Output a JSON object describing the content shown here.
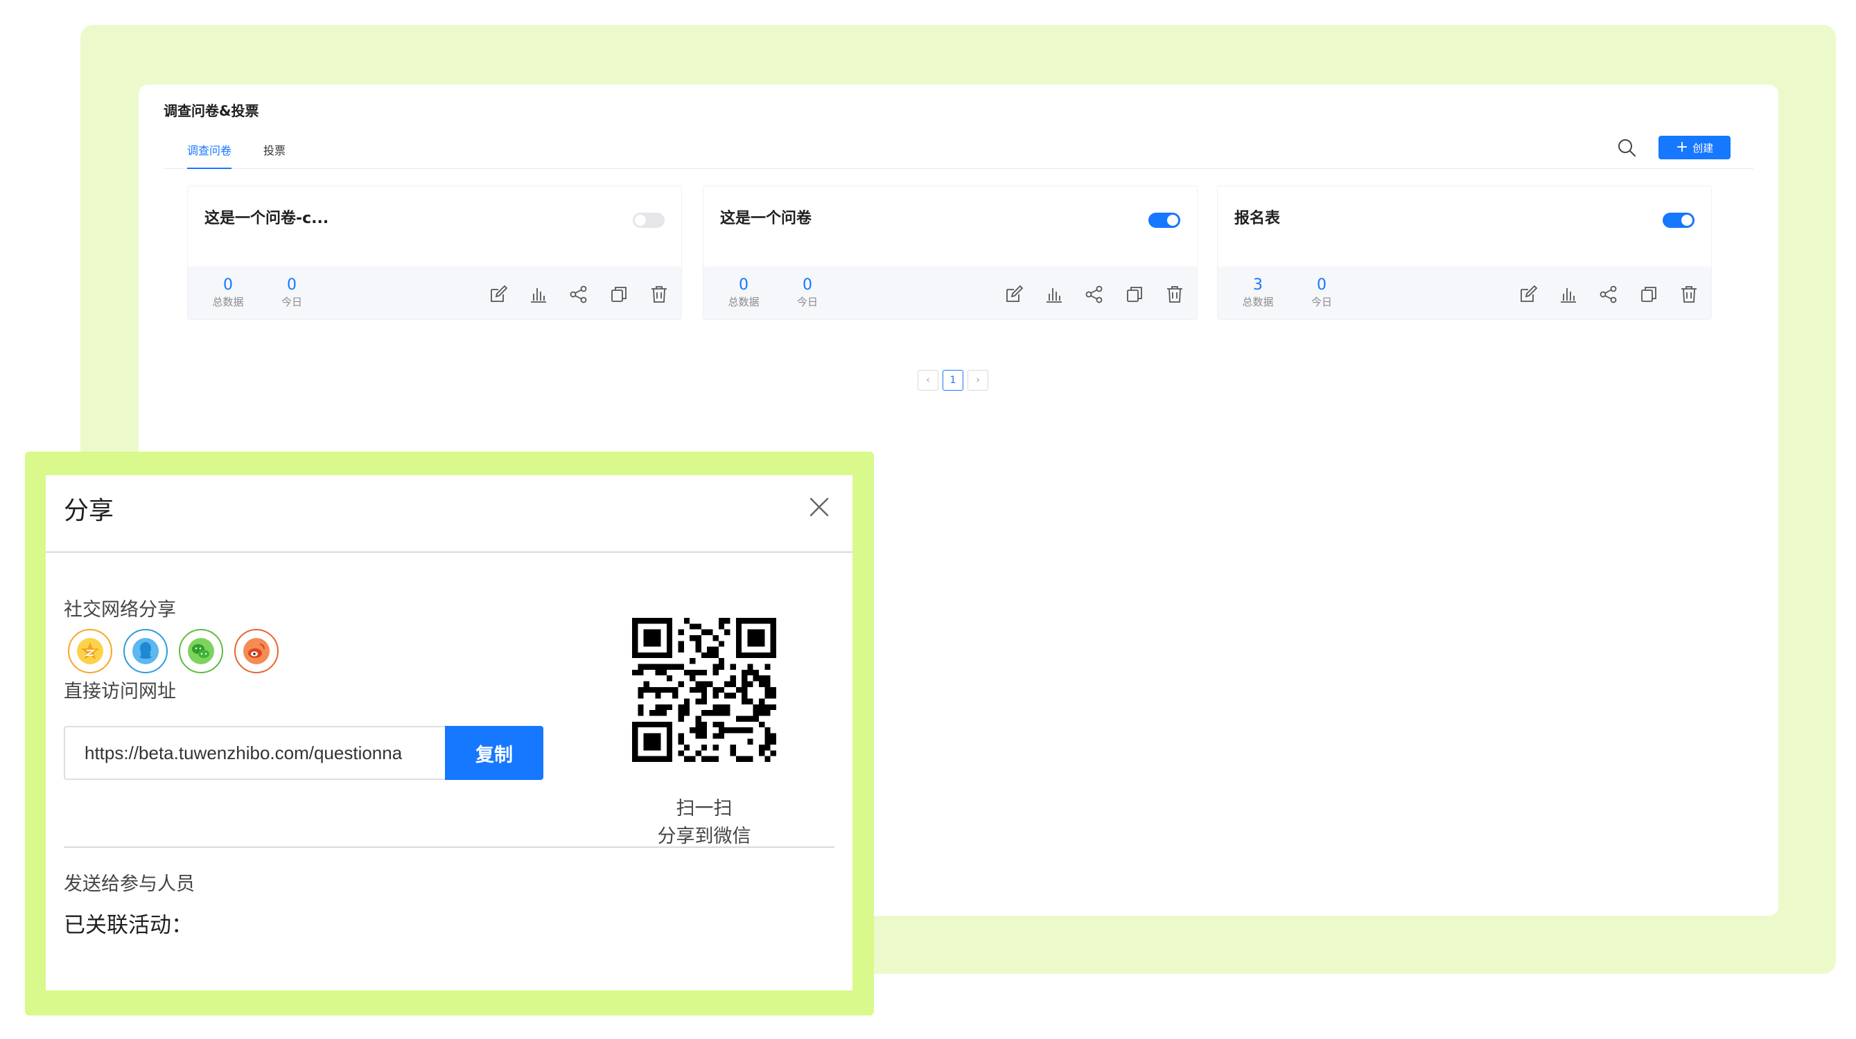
{
  "page": {
    "title": "调查问卷&投票",
    "tabs": [
      {
        "label": "调查问卷",
        "active": true
      },
      {
        "label": "投票",
        "active": false
      }
    ],
    "create_label": "创建",
    "accent_color": "#1677ff"
  },
  "cards": [
    {
      "title": "这是一个问卷-c...",
      "enabled": false,
      "total": "0",
      "today": "0",
      "total_label": "总数据",
      "today_label": "今日"
    },
    {
      "title": "这是一个问卷",
      "enabled": true,
      "total": "0",
      "today": "0",
      "total_label": "总数据",
      "today_label": "今日"
    },
    {
      "title": "报名表",
      "enabled": true,
      "total": "3",
      "today": "0",
      "total_label": "总数据",
      "today_label": "今日"
    }
  ],
  "pagination": {
    "prev": "‹",
    "current": "1",
    "next": "›"
  },
  "share_modal": {
    "title": "分享",
    "social_label": "社交网络分享",
    "social_icons": [
      "qzone-icon",
      "qq-icon",
      "wechat-icon",
      "weibo-icon"
    ],
    "url_label": "直接访问网址",
    "url_value": "https://beta.tuwenzhibo.com/questionna",
    "copy_label": "复制",
    "qr_caption_line1": "扫一扫",
    "qr_caption_line2": "分享到微信",
    "send_label": "发送给参与人员",
    "linked_label": "已关联活动："
  }
}
